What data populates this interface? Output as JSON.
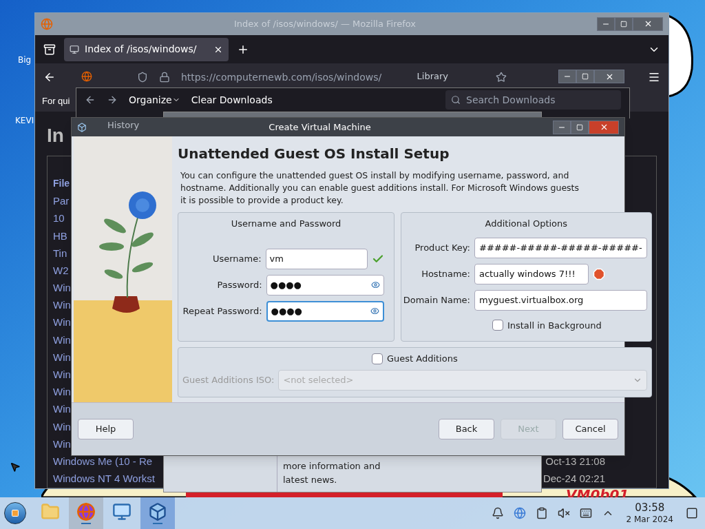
{
  "desktop": {
    "icons": [
      {
        "label": "Big"
      },
      {
        "label": "KEVI"
      }
    ],
    "wallpaper_text": "VM0b01"
  },
  "firefox": {
    "title": "Index of /isos/windows/ — Mozilla Firefox",
    "tabs": [
      {
        "label": "Index of /isos/windows/",
        "selected": true
      }
    ],
    "url": "https://computernewb.com/isos/windows/",
    "bookmarks_text": "For qui",
    "page_heading": "In",
    "table": {
      "header": "File",
      "rows": [
        {
          "name": "Par"
        },
        {
          "name": "10"
        },
        {
          "name": "HB"
        },
        {
          "name": "Tin"
        },
        {
          "name": "W2"
        },
        {
          "name": "Win"
        },
        {
          "name": "Win"
        },
        {
          "name": "Win"
        },
        {
          "name": "Win"
        },
        {
          "name": "Win"
        },
        {
          "name": "Win"
        },
        {
          "name": "Win"
        },
        {
          "name": "Win"
        },
        {
          "name": "Win"
        },
        {
          "name": "Win"
        },
        {
          "name": "Windows Me (10 - Re",
          "date": "Oct-13 21:08"
        },
        {
          "name": "Windows NT 4 Workst",
          "date": "Dec-24 02:21"
        }
      ]
    }
  },
  "library": {
    "title": "Library",
    "menu": [
      "Organize",
      "Clear Downloads"
    ],
    "search_placeholder": "Search Downloads",
    "sidebar": [
      {
        "label": "History"
      }
    ]
  },
  "vbox_manager": {
    "welcome_tail": "more information and latest news."
  },
  "dialog": {
    "title": "Create Virtual Machine",
    "heading": "Unattended Guest OS Install Setup",
    "description": "You can configure the unattended guest OS install by modifying username, password, and hostname. Additionally you can enable guest additions install. For Microsoft Windows guests it is possible to provide a product key.",
    "user_group": {
      "title": "Username and Password",
      "fields": [
        {
          "label": "Username:",
          "value": "vm",
          "kind": "text",
          "ok": true,
          "focused": false
        },
        {
          "label": "Password:",
          "value": "●●●●",
          "kind": "password",
          "ok": false,
          "focused": false
        },
        {
          "label": "Repeat Password:",
          "value": "●●●●",
          "kind": "password",
          "ok": false,
          "focused": true
        }
      ]
    },
    "options_group": {
      "title": "Additional Options",
      "fields": [
        {
          "label": "Product Key:",
          "value": "#####-#####-#####-#####-",
          "warning": false
        },
        {
          "label": "Hostname:",
          "value": "actually windows 7!!!",
          "warning": true
        },
        {
          "label": "Domain Name:",
          "value": "myguest.virtualbox.org",
          "warning": false
        }
      ],
      "install_in_background": {
        "label": "Install in Background",
        "checked": false
      }
    },
    "guest_additions": {
      "label": "Guest Additions",
      "checked": false,
      "iso_label": "Guest Additions ISO:",
      "iso_value": "<not selected>",
      "disabled": true
    },
    "buttons": [
      {
        "label": "Help",
        "disabled": false
      },
      {
        "label": "Back",
        "disabled": false
      },
      {
        "label": "Next",
        "disabled": true
      },
      {
        "label": "Cancel",
        "disabled": false
      }
    ]
  },
  "taskbar": {
    "apps": [
      {
        "kind": "folder",
        "running": false,
        "selected": false
      },
      {
        "kind": "firefox",
        "running": true,
        "selected": false
      },
      {
        "kind": "monitor",
        "running": false,
        "selected": false
      },
      {
        "kind": "virtualbox",
        "running": true,
        "selected": true
      }
    ],
    "clock": {
      "time": "03:58",
      "date": "2 Mar 2024"
    }
  }
}
